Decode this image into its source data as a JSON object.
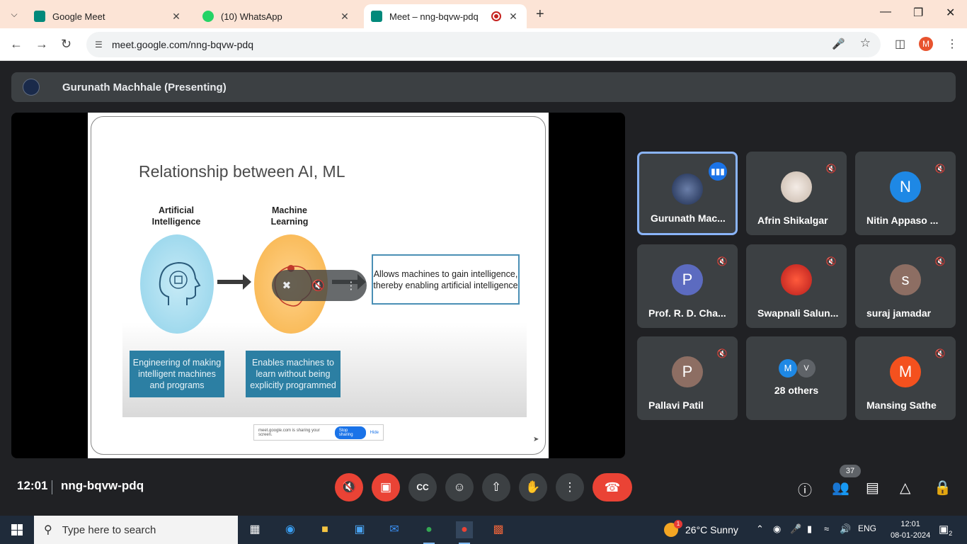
{
  "browser": {
    "tabs": [
      {
        "title": "Google Meet",
        "favicon_color": "#00897b"
      },
      {
        "title": "(10) WhatsApp",
        "favicon_color": "#25d366"
      },
      {
        "title": "Meet – nng-bqvw-pdq",
        "favicon_color": "#00897b"
      }
    ],
    "new_tab": "+",
    "url": "meet.google.com/nng-bqvw-pdq",
    "profile_initial": "M"
  },
  "meet": {
    "presenter_label": "Gurunath Machhale (Presenting)",
    "slide": {
      "title": "Relationship between AI, ML",
      "ai_label": "Artificial\nIntelligence",
      "ml_label": "Machine\nLearning",
      "definition": "Allows machines to gain intelligence, thereby enabling artificial intelligence",
      "ai_box": "Engineering of making intelligent machines and programs",
      "ml_box": "Enables machines to learn without being explicitly programmed",
      "sharebar_text": "meet.google.com is sharing your screen.",
      "stop_sharing": "Stop sharing",
      "hide": "Hide"
    },
    "participants": [
      {
        "name": "Gurunath Mac...",
        "initial": "",
        "color": "#2c3e66",
        "speaking": true
      },
      {
        "name": "Afrin Shikalgar",
        "initial": "",
        "color": "#e9dcd2",
        "speaking": false
      },
      {
        "name": "Nitin Appaso ...",
        "initial": "N",
        "color": "#1e88e5",
        "speaking": false
      },
      {
        "name": "Prof. R. D. Cha...",
        "initial": "P",
        "color": "#5c6bc0",
        "speaking": false
      },
      {
        "name": "Swapnali Salun...",
        "initial": "",
        "color": "#d32f2f",
        "speaking": false
      },
      {
        "name": "suraj jamadar",
        "initial": "s",
        "color": "#8d6e63",
        "speaking": false
      },
      {
        "name": "Pallavi Patil",
        "initial": "P",
        "color": "#8d6e63",
        "speaking": false
      },
      {
        "name": "28 others",
        "initial": "",
        "color": "#3c4043",
        "speaking": false
      },
      {
        "name": "Mansing Sathe",
        "initial": "M",
        "color": "#f4511e",
        "speaking": false
      }
    ],
    "others_avatars": [
      {
        "initial": "M",
        "color": "#1e88e5"
      },
      {
        "initial": "V",
        "color": "#5f6368"
      }
    ],
    "time": "12:01",
    "meeting_code": "nng-bqvw-pdq",
    "people_count": "37"
  },
  "taskbar": {
    "search_placeholder": "Type here to search",
    "weather": "26°C  Sunny",
    "weather_badge": "1",
    "language": "ENG",
    "clock_time": "12:01",
    "clock_date": "08-01-2024",
    "notification_count": "2"
  }
}
